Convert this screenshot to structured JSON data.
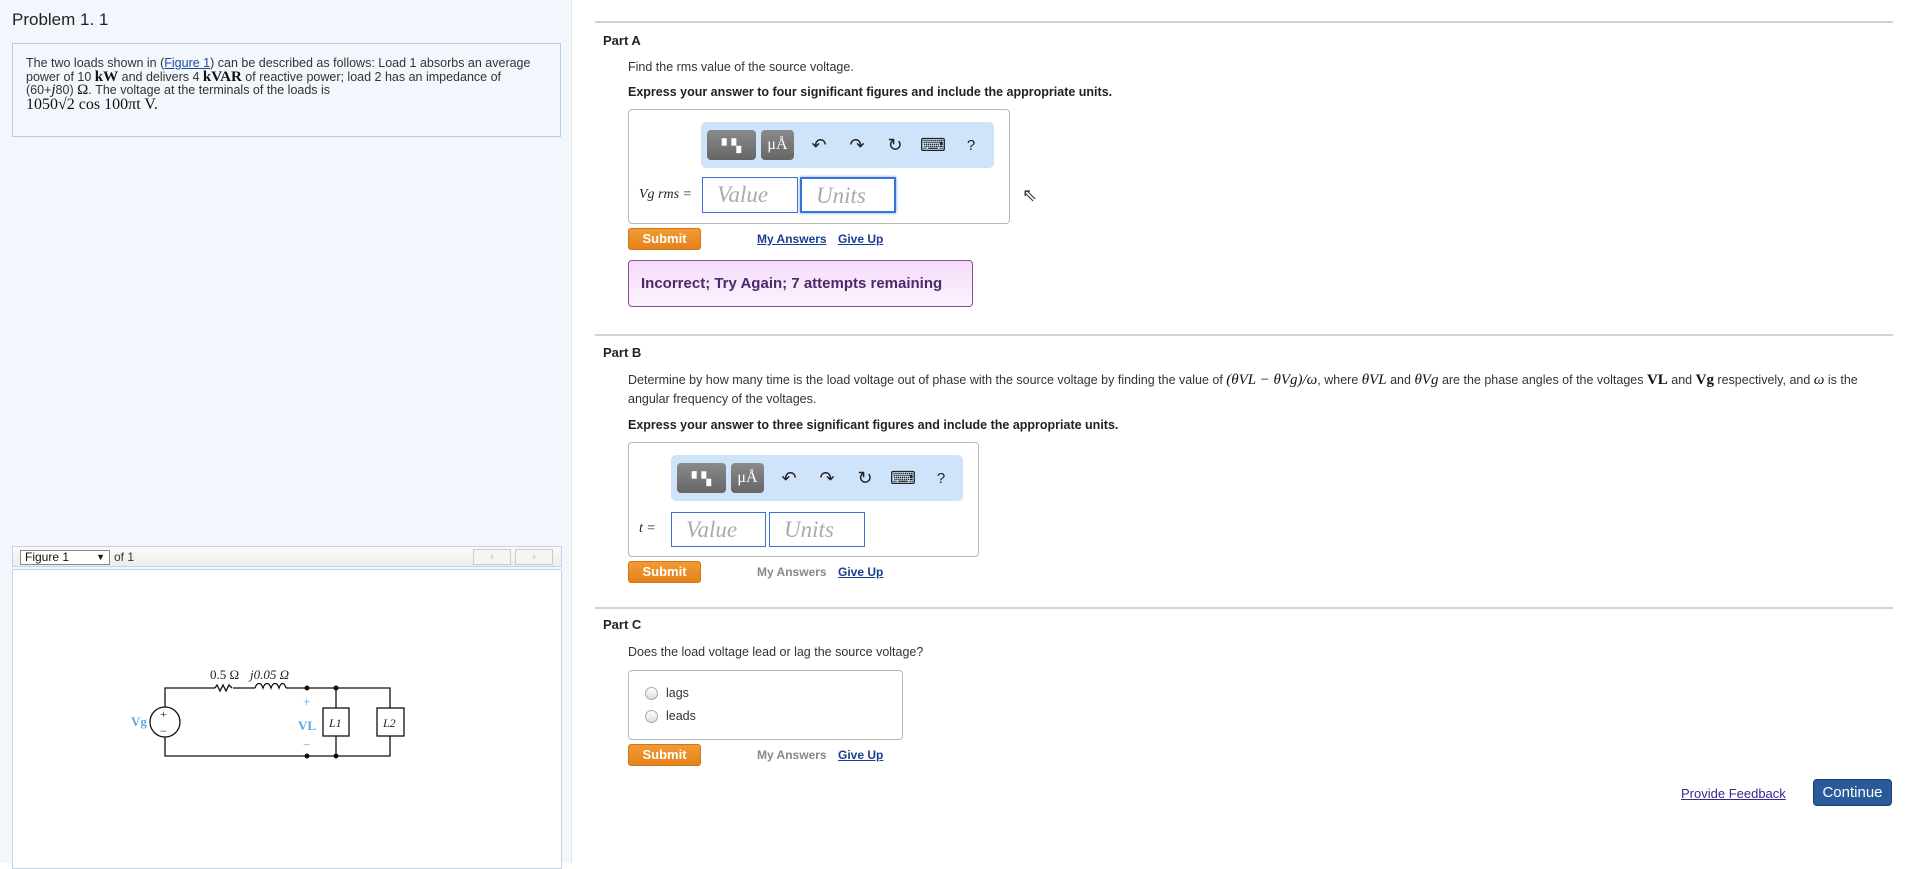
{
  "problem": {
    "title": "Problem 1. 1",
    "text_1": "The two loads shown in (",
    "figure_link": "Figure 1",
    "text_2": ") can be described as follows: Load 1 absorbs an average power of 10 ",
    "kw": "kW",
    "text_3": " and delivers 4 ",
    "kvar": "kVAR",
    "text_4": " of reactive power; load 2 has an impedance of (60+",
    "j": "j",
    "text_5": "80) ",
    "ohm": "Ω",
    "text_6": ". The voltage at the terminals of the loads is",
    "voltage": "1050√2 cos 100πt V."
  },
  "figure": {
    "select_label": "Figure 1",
    "of_label": "of 1",
    "prev": "‹",
    "next": "›",
    "labels": {
      "r": "0.5 Ω",
      "l": "j0.05 Ω",
      "vg": "Vg",
      "vl": "VL",
      "plus": "+",
      "minus": "−",
      "src_plus": "+",
      "src_minus": "−",
      "l1": "L1",
      "l2": "L2"
    }
  },
  "parts": {
    "a": {
      "label": "Part A",
      "question": "Find the rms value of the source voltage.",
      "instruction": "Express your answer to four significant figures and include the appropriate units.",
      "var_label": "Vg rms =",
      "value_placeholder": "Value",
      "units_placeholder": "Units",
      "submit": "Submit",
      "my_answers": "My Answers",
      "give_up": "Give Up",
      "feedback": "Incorrect; Try Again; 7 attempts remaining"
    },
    "b": {
      "label": "Part B",
      "q1": "Determine by how many time is the load voltage out of phase with the source voltage by finding the value of ",
      "math1": "(θVL − θVg)/ω",
      "q2": ", where ",
      "math2": "θVL",
      "q3": " and ",
      "math3": "θVg",
      "q4": " are the phase angles of the voltages ",
      "math4": "VL",
      "q5": " and ",
      "math5": "Vg",
      "q6": " respectively, and ",
      "math6": "ω",
      "q7": " is the angular frequency of the voltages.",
      "instruction": "Express your answer to three significant figures and include the appropriate units.",
      "var_label": "t =",
      "value_placeholder": "Value",
      "units_placeholder": "Units",
      "submit": "Submit",
      "my_answers": "My Answers",
      "give_up": "Give Up"
    },
    "c": {
      "label": "Part C",
      "question": "Does the load voltage lead or lag the source voltage?",
      "options": [
        "lags",
        "leads"
      ],
      "submit": "Submit",
      "my_answers": "My Answers",
      "give_up": "Give Up"
    }
  },
  "toolbar": {
    "templates": "▘▚",
    "units": "μÅ",
    "undo": "↶",
    "redo": "↷",
    "reset": "↻",
    "keyboard": "⌨",
    "help": "?"
  },
  "footer": {
    "feedback": "Provide Feedback",
    "continue": "Continue"
  }
}
